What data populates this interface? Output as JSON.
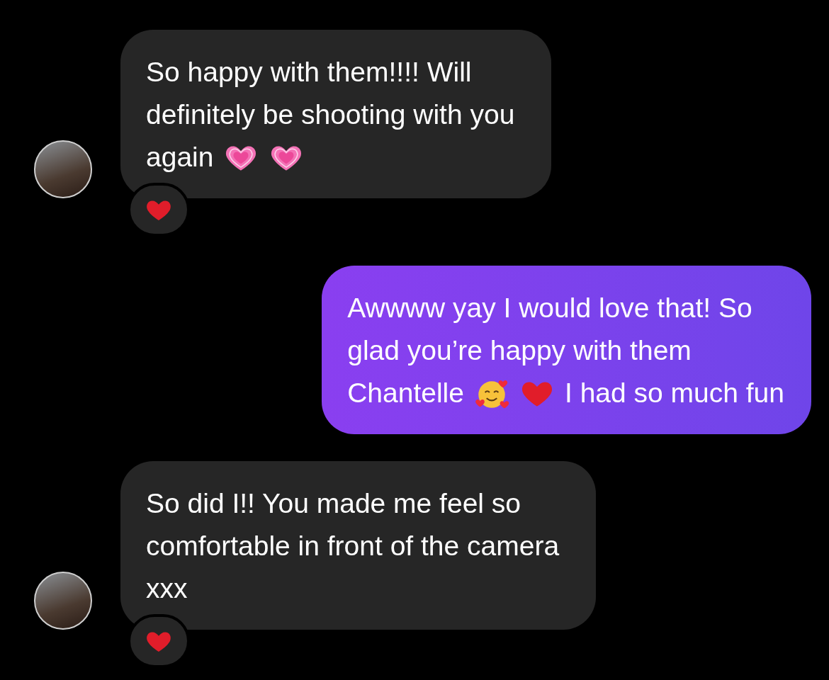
{
  "messages": [
    {
      "kind": "received",
      "lines": [
        [
          {
            "kind": "text",
            "text": "So happy with them!!!! Will"
          }
        ],
        [
          {
            "kind": "text",
            "text": "definitely be shooting with you"
          }
        ],
        [
          {
            "kind": "text",
            "text": "again"
          },
          {
            "kind": "pink-heart"
          },
          {
            "kind": "pink-heart"
          }
        ]
      ],
      "reaction": {
        "kind": "red-heart"
      }
    },
    {
      "kind": "sent",
      "lines": [
        [
          {
            "kind": "text",
            "text": "Awwww yay I would love that! So"
          }
        ],
        [
          {
            "kind": "text",
            "text": "glad you’re happy with them"
          }
        ],
        [
          {
            "kind": "text",
            "text": "Chantelle"
          },
          {
            "kind": "smiling-face-hearts"
          },
          {
            "kind": "red-heart"
          },
          {
            "kind": "text",
            "text": "I had so much fun"
          }
        ]
      ]
    },
    {
      "kind": "received",
      "lines": [
        [
          {
            "kind": "text",
            "text": "So did I!! You made me feel so"
          }
        ],
        [
          {
            "kind": "text",
            "text": "comfortable in front of the camera"
          }
        ],
        [
          {
            "kind": "text",
            "text": "xxx"
          }
        ]
      ],
      "reaction": {
        "kind": "red-heart"
      }
    }
  ]
}
